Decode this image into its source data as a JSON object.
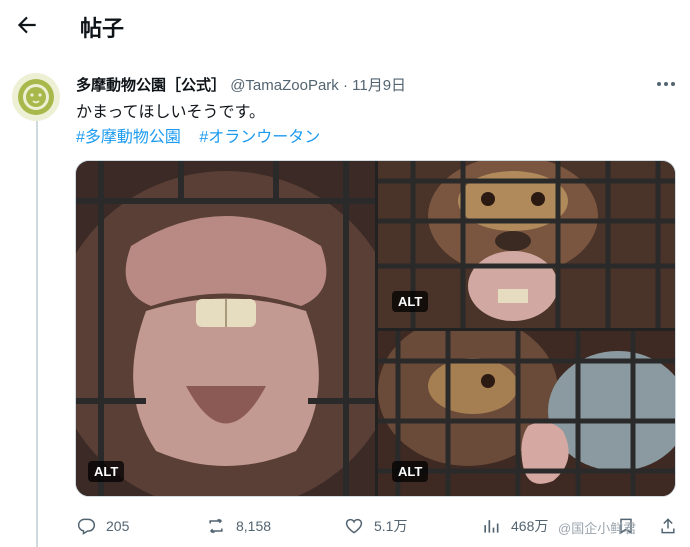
{
  "header": {
    "title": "帖子"
  },
  "post": {
    "author_name": "多摩動物公園［公式］",
    "handle": "@TamaZooPark",
    "dot": "·",
    "date": "11月9日",
    "text": "かまってほしいそうです。",
    "hashtags": [
      "#多摩動物公園",
      "#オランウータン"
    ]
  },
  "media": {
    "alt_label": "ALT",
    "items": [
      {
        "alt_badge": "ALT"
      },
      {
        "alt_badge": "ALT"
      },
      {
        "alt_badge": "ALT"
      }
    ]
  },
  "actions": {
    "replies": "205",
    "reposts": "8,158",
    "likes": "5.1万",
    "views": "468万"
  },
  "watermark": "@国企小鲜君",
  "colors": {
    "accent": "#1d9bf0",
    "text": "#0f1419",
    "muted": "#536471",
    "line": "#cfd9de"
  }
}
